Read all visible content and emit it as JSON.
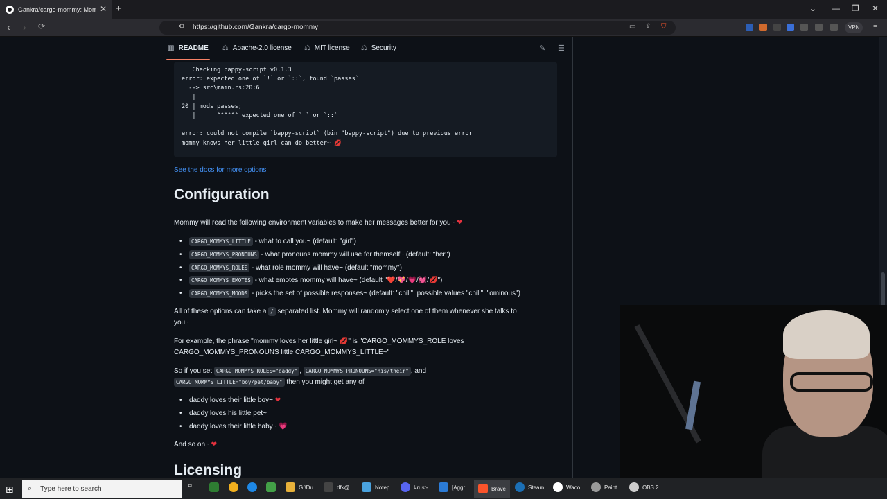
{
  "browser": {
    "tab_title": "Gankra/cargo-mommy: Mommy",
    "tab_close": "✕",
    "new_tab": "+",
    "url": "https://github.com/Gankra/cargo-mommy",
    "vpn_label": "VPN"
  },
  "readme_tabs": [
    {
      "label": "README",
      "icon": "book-icon"
    },
    {
      "label": "Apache-2.0 license",
      "icon": "scale-icon"
    },
    {
      "label": "MIT license",
      "icon": "scale-icon"
    },
    {
      "label": "Security",
      "icon": "scale-icon"
    }
  ],
  "code_block": "   Checking bappy-script v0.1.3\nerror: expected one of `!` or `::`, found `passes`\n  --> src\\main.rs:20:6\n   |\n20 | mods passes;\n   |      ^^^^^^ expected one of `!` or `::`\n\nerror: could not compile `bappy-script` (bin \"bappy-script\") due to previous error\nmommy knows her little girl can do better~ 💋",
  "docs_link": "See the docs for more options",
  "config_heading": "Configuration",
  "config_intro": "Mommy will read the following environment variables to make her messages better for you~",
  "heart": "❤",
  "env_vars": [
    {
      "name": "CARGO_MOMMYS_LITTLE",
      "desc": " - what to call you~ (default: \"girl\")"
    },
    {
      "name": "CARGO_MOMMYS_PRONOUNS",
      "desc": " - what pronouns mommy will use for themself~ (default: \"her\")"
    },
    {
      "name": "CARGO_MOMMYS_ROLES",
      "desc": " - what role mommy will have~ (default \"mommy\")"
    },
    {
      "name": "CARGO_MOMMYS_EMOTES",
      "desc": " - what emotes mommy will have~ (default \"❤️/💖/💗/💓/💋\")"
    },
    {
      "name": "CARGO_MOMMYS_MOODS",
      "desc": " - picks the set of possible responses~ (default: \"chill\", possible values \"chill\", \"ominous\")"
    }
  ],
  "sep_para": {
    "before": "All of these options can take a ",
    "code": "/",
    "after_line1": " separated list. Mommy will randomly select one of them whenever she talks to",
    "line2": "you~"
  },
  "example_para": {
    "line1": "For example, the phrase \"mommy loves her little girl~ 💋\" is \"CARGO_MOMMYS_ROLE loves",
    "line2": "CARGO_MOMMYS_PRONOUNS little CARGO_MOMMYS_LITTLE~\""
  },
  "so_para": {
    "t1": "So if you set ",
    "c1": "CARGO_MOMMYS_ROLES=\"daddy\"",
    "t2": ", ",
    "c2": "CARGO_MOMMYS_PRONOUNS=\"his/their\"",
    "t3": ", and",
    "c3": "CARGO_MOMMYS_LITTLE=\"boy/pet/baby\"",
    "t4": " then you might get any of"
  },
  "examples": [
    {
      "text": "daddy loves their little boy~",
      "emote": "❤"
    },
    {
      "text": "daddy loves his little pet~",
      "emote": ""
    },
    {
      "text": "daddy loves their little baby~",
      "emote": "💗"
    }
  ],
  "and_so_on": "And so on~",
  "licensing_heading": "Licensing",
  "taskbar": {
    "search_placeholder": "Type here to search",
    "apps": [
      {
        "label": "G:\\Du...",
        "color": "#e8b13a"
      },
      {
        "label": "dfk@...",
        "color": "#444"
      },
      {
        "label": "Notep...",
        "color": "#4aa3df"
      },
      {
        "label": "#rust-...",
        "color": "#5865f2"
      },
      {
        "label": "[Aggr...",
        "color": "#2b7bd6"
      },
      {
        "label": "Brave",
        "color": "#fb542b"
      },
      {
        "label": "Steam",
        "color": "#1b6fb5"
      },
      {
        "label": "Waco...",
        "color": "#ffffff"
      },
      {
        "label": "Paint",
        "color": "#9a9a9a"
      },
      {
        "label": "OBS 2...",
        "color": "#cccccc"
      }
    ]
  }
}
